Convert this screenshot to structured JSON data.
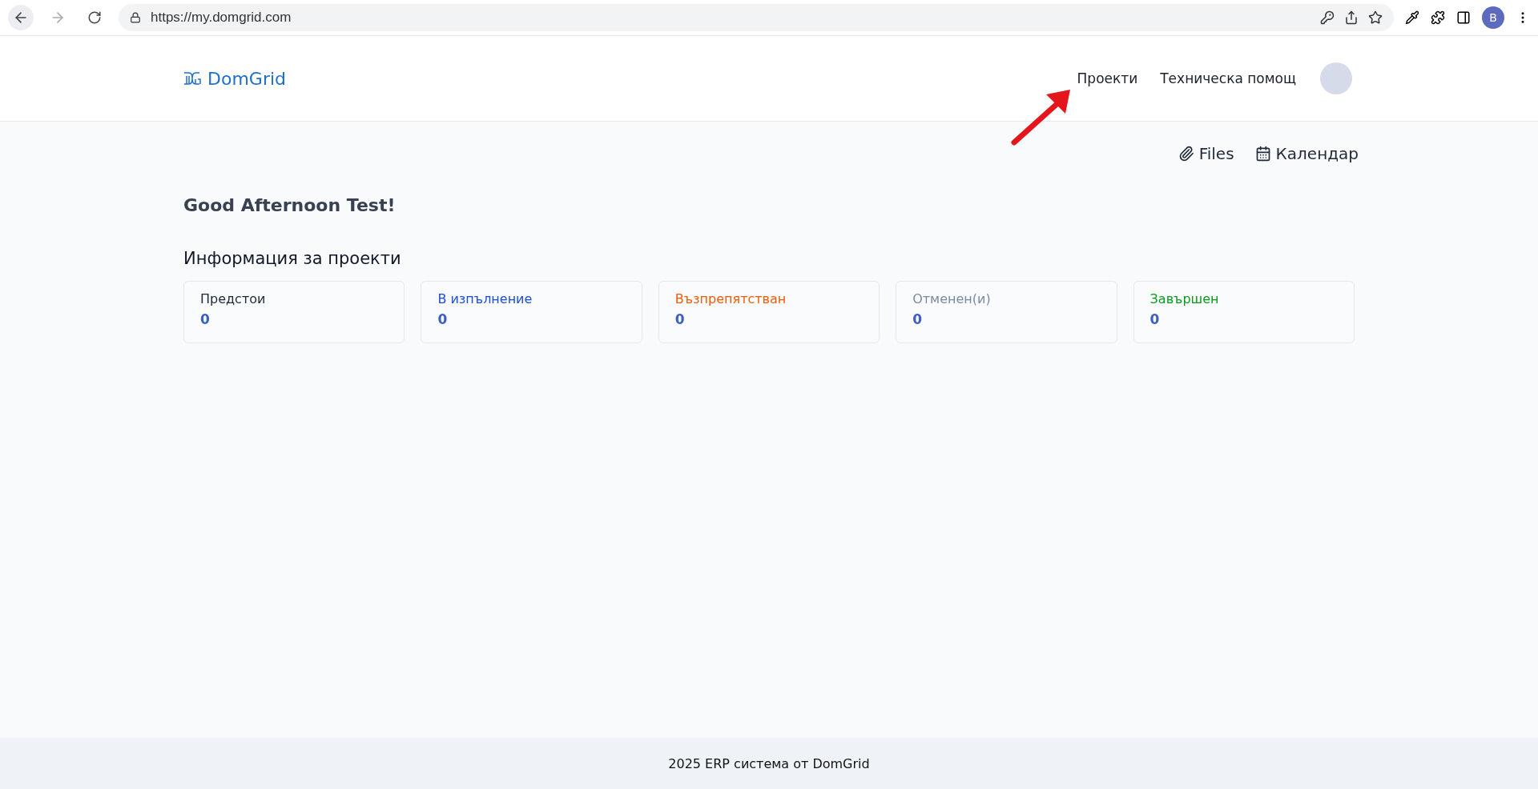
{
  "browser": {
    "url": "https://my.domgrid.com",
    "profile_initial": "B"
  },
  "header": {
    "logo": "DomGrid",
    "nav": [
      {
        "label": "Проекти"
      },
      {
        "label": "Техническа помощ"
      }
    ]
  },
  "toolbar": [
    {
      "kind": "files",
      "label": "Files"
    },
    {
      "kind": "calendar",
      "label": "Календар"
    }
  ],
  "greeting": "Good Afternoon Test!",
  "section_title": "Информация за проекти",
  "status_cards": [
    {
      "label": "Предстои",
      "count": "0",
      "color": "#1f2937"
    },
    {
      "label": "В изпълнение",
      "count": "0",
      "color": "#1d4ed8"
    },
    {
      "label": "Възпрепятстван",
      "count": "0",
      "color": "#f25c05"
    },
    {
      "label": "Отменен(и)",
      "count": "0",
      "color": "#7b8aa3"
    },
    {
      "label": "Завършен",
      "count": "0",
      "color": "#0a9a1e"
    }
  ],
  "footer": "2025 ERP система от DomGrid"
}
